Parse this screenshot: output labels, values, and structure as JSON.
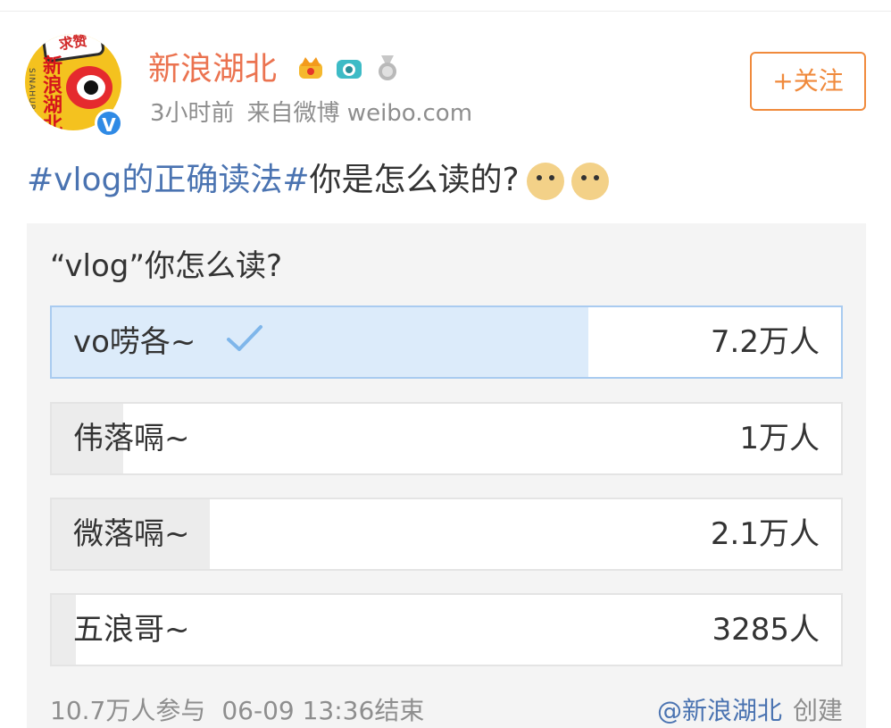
{
  "account": {
    "name": "新浪湖北",
    "avatar_badge": "求赞",
    "avatar_text": "新浪湖北",
    "avatar_side_text": "SINAHUBEI",
    "verified_mark": "V",
    "badge_icons": [
      "crown-icon",
      "camera-icon",
      "medal-icon"
    ]
  },
  "meta": {
    "time": "3小时前",
    "source": "来自微博 weibo.com"
  },
  "follow_button": {
    "label": "+关注"
  },
  "post": {
    "hashtag": "#vlog的正确读法#",
    "text": "你是怎么读的?",
    "emojis": [
      "doge-emoji",
      "doge-emoji"
    ]
  },
  "poll": {
    "question": "“vlog”你怎么读?",
    "options": [
      {
        "label": "vo唠各~",
        "count": "7.2万人",
        "share": 0.68,
        "selected": true
      },
      {
        "label": "伟落嗝~",
        "count": "1万人",
        "share": 0.09,
        "selected": false
      },
      {
        "label": "微落嗝~",
        "count": "2.1万人",
        "share": 0.2,
        "selected": false
      },
      {
        "label": "五浪哥~",
        "count": "3285人",
        "share": 0.03,
        "selected": false
      }
    ],
    "participants": "10.7万人参与",
    "end_time": "06-09 13:36结束",
    "creator": "@新浪湖北",
    "created_label": "创建"
  },
  "colors": {
    "accent_orange": "#eb7350",
    "link_blue": "#4a73b1",
    "selected_fill": "#dcebfa",
    "selected_border": "#a9cbf0",
    "check_blue": "#7fb6ea"
  }
}
